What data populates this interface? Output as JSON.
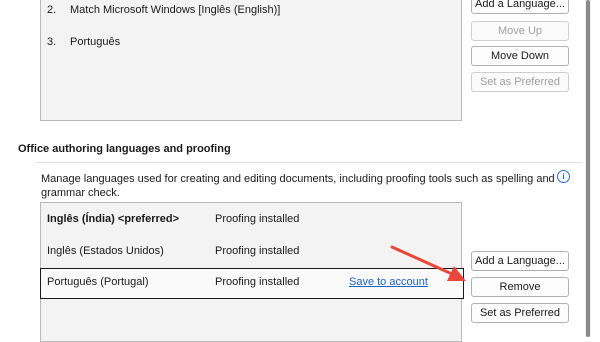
{
  "display_languages": {
    "items": [
      {
        "number": "2.",
        "label": "Match Microsoft Windows [Inglês (English)]"
      },
      {
        "number": "3.",
        "label": "Português"
      }
    ],
    "buttons": {
      "add_language": "Add a Language...",
      "move_up": "Move Up",
      "move_down": "Move Down",
      "set_preferred": "Set as Preferred"
    }
  },
  "authoring": {
    "title": "Office authoring languages and proofing",
    "description": "Manage languages used for creating and editing documents, including proofing tools such as spelling and grammar check.",
    "info_icon": "i",
    "rows": [
      {
        "language": "Inglês (Índia) <preferred>",
        "status": "Proofing installed",
        "link": ""
      },
      {
        "language": "Inglês (Estados Unidos)",
        "status": "Proofing installed",
        "link": ""
      },
      {
        "language": "Português (Portugal)",
        "status": "Proofing installed",
        "link": "Save to account"
      }
    ],
    "buttons": {
      "add_language": "Add a Language...",
      "remove": "Remove",
      "set_preferred": "Set as Preferred"
    }
  },
  "colors": {
    "accent_link": "#1c63c5",
    "annotation_arrow": "#e8473b"
  },
  "icons": {
    "info": "info-icon",
    "arrow": "annotation-arrow-icon"
  }
}
